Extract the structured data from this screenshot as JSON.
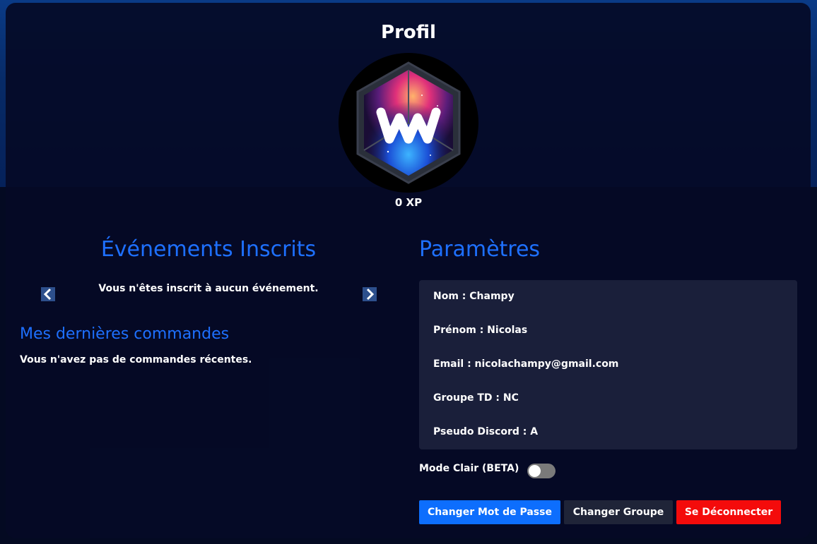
{
  "colors": {
    "accent": "#1e70ff",
    "primary_button": "#0d6efd",
    "secondary_button": "#1f2438",
    "danger_button": "#f40b0b",
    "panel": "#1a1f3a",
    "background": "#040a22"
  },
  "profile": {
    "title": "Profil",
    "avatar_icon": "ww-logo-icon",
    "xp": "0 XP"
  },
  "events": {
    "title": "Événements Inscrits",
    "empty_message": "Vous n'êtes inscrit à aucun événement.",
    "prev_icon": "chevron-left-icon",
    "next_icon": "chevron-right-icon"
  },
  "orders": {
    "title": "Mes dernières commandes",
    "empty_message": "Vous n'avez pas de commandes récentes."
  },
  "settings": {
    "title": "Paramètres",
    "fields": [
      "Nom : Champy",
      "Prénom : Nicolas",
      "Email : nicolachampy@gmail.com",
      "Groupe TD : NC",
      "Pseudo Discord : A"
    ],
    "light_mode_label": "Mode Clair (BETA)",
    "light_mode_enabled": false
  },
  "actions": {
    "change_password": "Changer Mot de Passe",
    "change_group": "Changer Groupe",
    "logout": "Se Déconnecter"
  }
}
